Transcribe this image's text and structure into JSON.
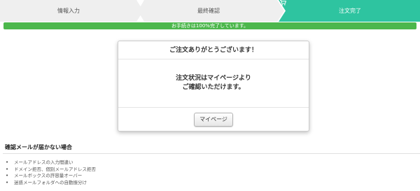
{
  "steps": [
    {
      "label": "情報入力",
      "state": "done"
    },
    {
      "label": "最終確認",
      "state": "done"
    },
    {
      "label": "注文完了",
      "state": "current",
      "icon": "cart-icon"
    }
  ],
  "progress": {
    "text": "お手続きは100%完了しています。",
    "percent": 100,
    "color": "#4cb74c"
  },
  "dialog": {
    "title": "ご注文ありがとうございます！",
    "message_lines": [
      "注文状況はマイページより",
      "ご確認いただけます。"
    ],
    "button_label": "マイページ"
  },
  "help": {
    "title": "確認メールが届かない場合",
    "items": [
      "メールアドレスの入力間違い",
      "ドメイン拒否、個別メールアドレス拒否",
      "メールボックスの許容量オーバー",
      "迷惑メールフォルダへの自動振分け"
    ]
  },
  "colors": {
    "current_step": "#2ec4a0",
    "step_bg": "#efefef",
    "progress": "#4cb74c"
  }
}
